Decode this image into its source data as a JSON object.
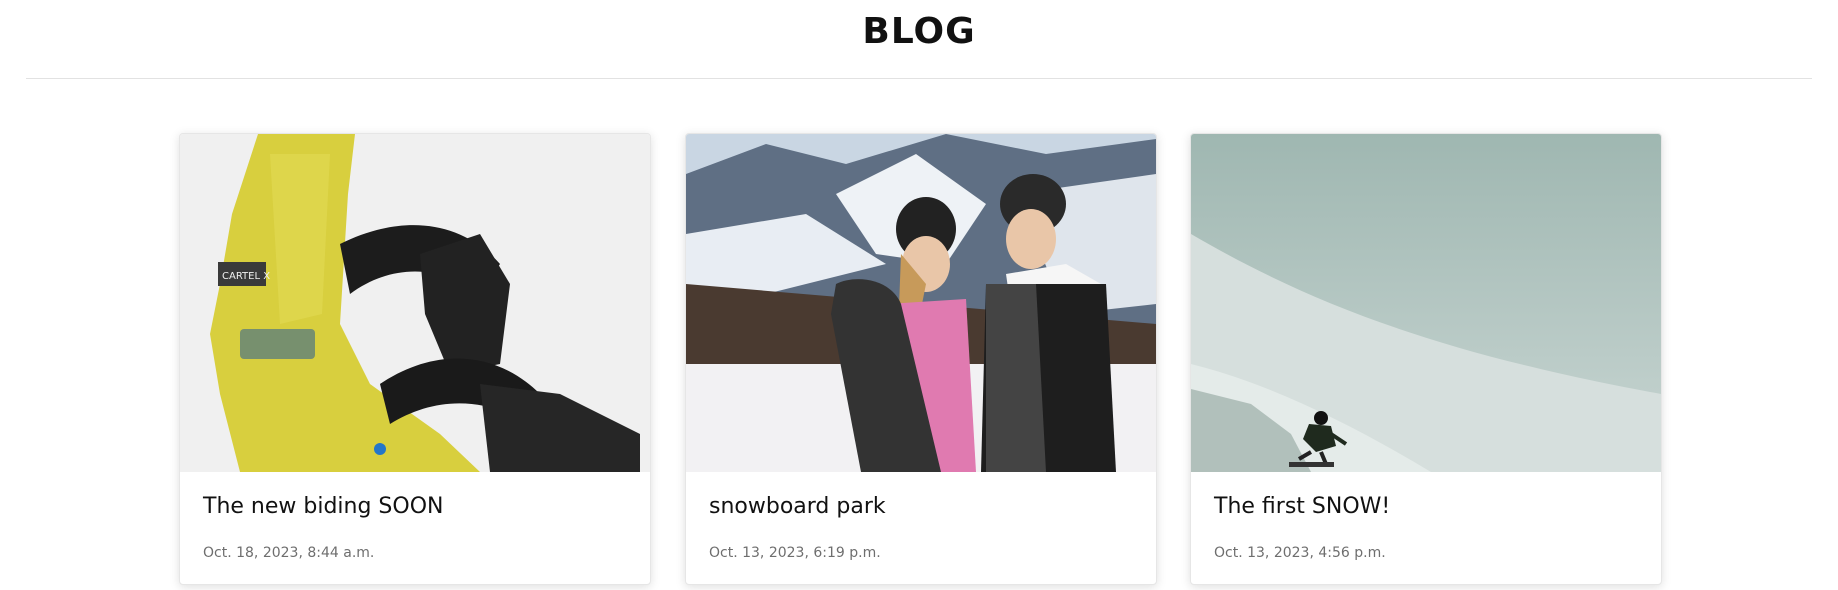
{
  "header": {
    "title": "BLOG"
  },
  "posts": [
    {
      "title": "The new biding SOON",
      "date": "Oct. 18, 2023, 8:44 a.m.",
      "image_icon": "snowboard-binding-image",
      "brand_label": "CARTEL X"
    },
    {
      "title": "snowboard park",
      "date": "Oct. 13, 2023, 6:19 p.m.",
      "image_icon": "snowboarders-photo"
    },
    {
      "title": "The first SNOW!",
      "date": "Oct. 13, 2023, 4:56 p.m.",
      "image_icon": "snowy-slope-photo"
    }
  ],
  "colors": {
    "binding_yellow": "#d8cf3e",
    "snow_mist": "#a9bfb8",
    "pink_suit": "#e07ab0"
  }
}
